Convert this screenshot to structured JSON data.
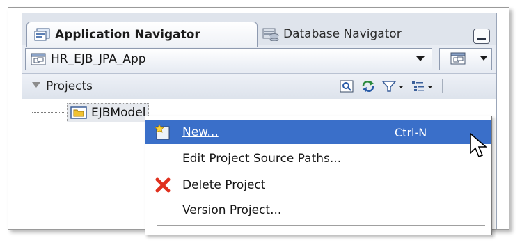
{
  "tabs": {
    "active_label": "Application Navigator",
    "inactive_label": "Database Navigator"
  },
  "app_selector": {
    "value": "HR_EJB_JPA_App"
  },
  "projects": {
    "label": "Projects"
  },
  "tree": {
    "items": [
      {
        "label": "EJBModel"
      }
    ]
  },
  "context_menu": {
    "items": [
      {
        "label": "New...",
        "shortcut": "Ctrl-N"
      },
      {
        "label": "Edit Project Source Paths..."
      },
      {
        "label": "Delete Project"
      },
      {
        "label": "Version Project..."
      }
    ]
  },
  "icons": [
    "navigator-icon",
    "database-icon",
    "minimize-icon",
    "app-icon",
    "projects-collapse-icon",
    "find-icon",
    "refresh-icon",
    "filter-icon",
    "options-icon",
    "folder-icon",
    "new-icon",
    "delete-x-icon",
    "mouse-cursor-icon"
  ],
  "colors": {
    "selection": "#3a6fc9",
    "panel_bg": "#e8ecf3",
    "delete_red": "#e0301e"
  }
}
